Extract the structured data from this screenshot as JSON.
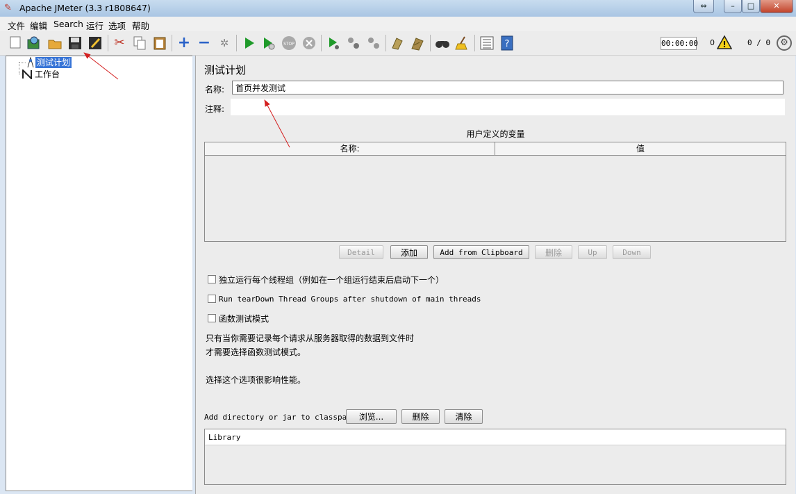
{
  "window": {
    "title": "Apache JMeter (3.3 r1808647)"
  },
  "menu": {
    "items": [
      "文件",
      "编辑",
      "Search",
      "运行",
      "选项",
      "帮助"
    ]
  },
  "toolbar": {
    "icons": [
      "new-icon",
      "templates-icon",
      "open-icon",
      "save-icon",
      "save-as-icon",
      "cut-icon",
      "copy-icon",
      "paste-icon",
      "expand-icon",
      "collapse-icon",
      "toggle-icon",
      "start-icon",
      "start-no-pause-icon",
      "stop-icon",
      "shutdown-icon",
      "remote-start-icon",
      "remote-stop-icon",
      "remote-shutdown-icon",
      "clear-icon",
      "clear-all-icon",
      "search-icon",
      "reset-search-icon",
      "function-helper-icon",
      "help-icon"
    ],
    "timer": "00:00:00",
    "error_count": "0",
    "threads": "0 / 0"
  },
  "tree": {
    "nodes": [
      {
        "label": "测试计划",
        "icon": "test-plan-icon",
        "selected": true
      },
      {
        "label": "工作台",
        "icon": "workbench-icon",
        "selected": false
      }
    ]
  },
  "panel": {
    "title": "测试计划",
    "name_label": "名称:",
    "name_value": "首页并发测试",
    "comment_label": "注释:",
    "comment_value": "",
    "vars_title": "用户定义的变量",
    "vars_columns": [
      "名称:",
      "值"
    ],
    "buttons": {
      "detail": "Detail",
      "add": "添加",
      "add_clipboard": "Add from Clipboard",
      "delete": "删除",
      "up": "Up",
      "down": "Down"
    },
    "checkboxes": {
      "independent": "独立运行每个线程组（例如在一个组运行结束后启动下一个）",
      "teardown": "Run tearDown Thread Groups after shutdown of main threads",
      "functional": "函数测试模式"
    },
    "info": {
      "line1": "只有当你需要记录每个请求从服务器取得的数据到文件时",
      "line2": "才需要选择函数测试模式。",
      "line3": "选择这个选项很影响性能。"
    },
    "classpath": {
      "label": "Add directory or jar to classpath",
      "browse": "浏览...",
      "delete": "删除",
      "clear": "清除",
      "library_header": "Library"
    }
  },
  "colors": {
    "selection": "#3875d7",
    "annotation": "#d42020"
  }
}
